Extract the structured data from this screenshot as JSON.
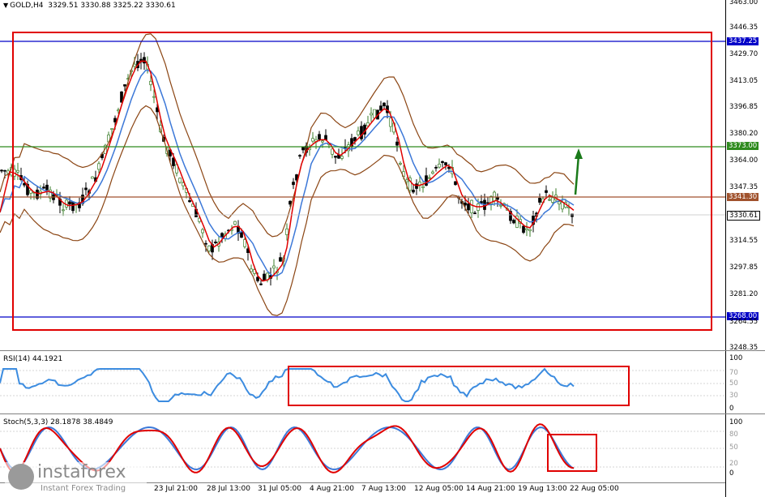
{
  "header": {
    "symbol": "GOLD,H4",
    "ohlc": "3329.51 3330.88 3325.22 3330.61"
  },
  "price_axis": {
    "ticks": [
      "3463.00",
      "3446.35",
      "3429.70",
      "3413.05",
      "3396.85",
      "3380.20",
      "3364.00",
      "3347.35",
      "3314.55",
      "3297.85",
      "3281.20",
      "3264.55",
      "3248.35"
    ],
    "tags": {
      "upper_blue": "3437.25",
      "green": "3373.00",
      "brown": "3341.30",
      "current": "3330.61",
      "lower_blue": "3268.00"
    }
  },
  "rsi": {
    "label": "RSI(14) 44.1921",
    "ticks": [
      "100",
      "70",
      "50",
      "30",
      "0"
    ]
  },
  "stoch": {
    "label": "Stoch(5,3,3) 28.1878 38.4849",
    "ticks": [
      "100",
      "80",
      "50",
      "20",
      "0"
    ]
  },
  "time_axis": [
    "23 Jul 21:00",
    "28 Jul 13:00",
    "31 Jul 05:00",
    "4 Aug 21:00",
    "7 Aug 13:00",
    "12 Aug 05:00",
    "14 Aug 21:00",
    "19 Aug 13:00",
    "22 Aug 05:00"
  ],
  "watermark": {
    "name": "instaforex",
    "tagline": "Instant Forex Trading"
  },
  "colors": {
    "bull": "#3a7d2a",
    "bear": "#000000",
    "red_frame": "#e00000",
    "blue_line": "#0000c8",
    "green_line": "#2e8b1e",
    "brown_line": "#a0522d",
    "bands": "#8b4513",
    "ma_fast": "#e00000",
    "ma_slow": "#3c78d8",
    "rsi_line": "#3c8ce0"
  }
}
